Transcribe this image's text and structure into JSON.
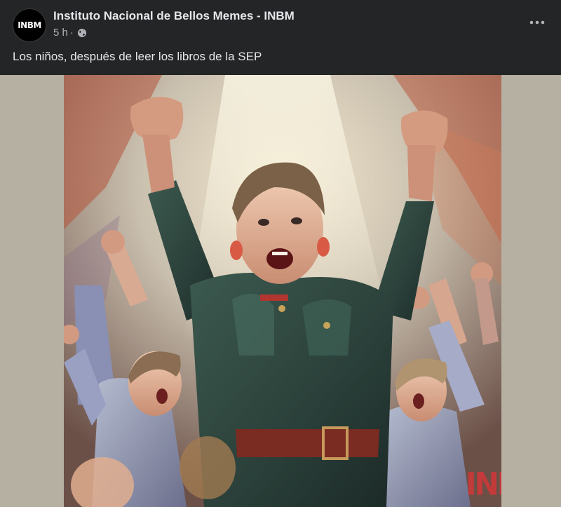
{
  "post": {
    "page_name": "Instituto Nacional de Bellos Memes - INBM",
    "avatar_text": "INBM",
    "time": "5 h",
    "separator": "·",
    "caption": "Los niños, después de leer los libros de la SEP",
    "more_label": "•••"
  },
  "media": {
    "watermark": "INBM"
  },
  "colors": {
    "background": "#242526",
    "text_primary": "#e4e6eb",
    "text_secondary": "#b0b3b8",
    "watermark": "#c23a3a"
  },
  "icons": {
    "privacy": "globe-icon",
    "more": "more-horizontal-icon"
  }
}
